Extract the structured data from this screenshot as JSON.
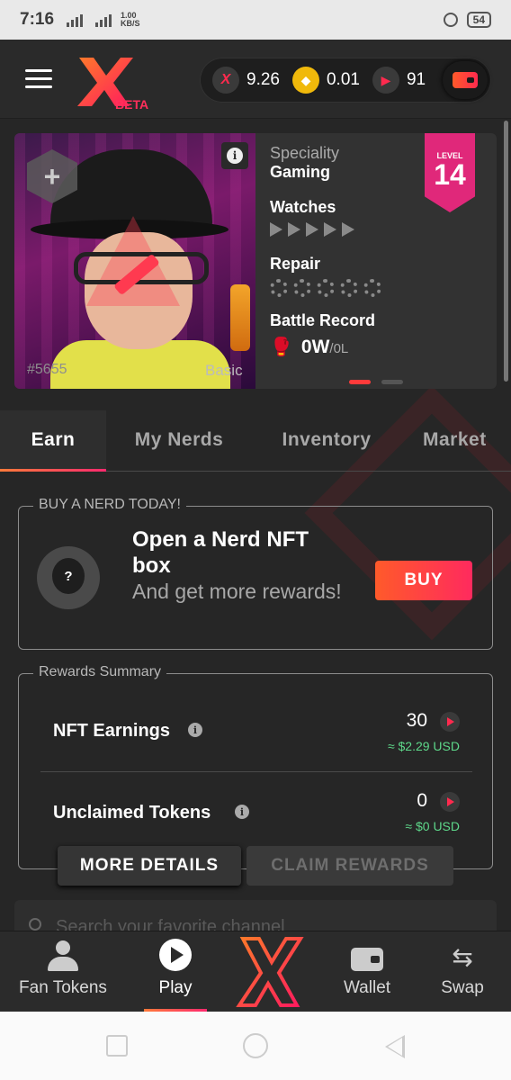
{
  "status_bar": {
    "time": "7:16",
    "net_speed_value": "1.00",
    "net_speed_unit": "KB/S",
    "battery": "54"
  },
  "header": {
    "beta_label": "BETA",
    "balances": [
      {
        "icon": "x-token-icon",
        "value": "9.26"
      },
      {
        "icon": "bnb-coin-icon",
        "value": "0.01"
      },
      {
        "icon": "play-token-icon",
        "value": "91"
      }
    ]
  },
  "nft_card": {
    "id_label": "#5655",
    "tier": "Basic",
    "speciality_label": "Speciality",
    "speciality_value": "Gaming",
    "watches_label": "Watches",
    "repair_label": "Repair",
    "battle_label": "Battle Record",
    "battle_wins": "0W",
    "battle_losses": "/0L",
    "level_label": "LEVEL",
    "level_value": "14"
  },
  "tabs": [
    {
      "label": "Earn",
      "active": true
    },
    {
      "label": "My Nerds",
      "active": false
    },
    {
      "label": "Inventory",
      "active": false
    },
    {
      "label": "Market",
      "active": false
    }
  ],
  "buy_box": {
    "legend": "BUY A NERD TODAY!",
    "title": "Open a Nerd NFT box",
    "subtitle": "And get more rewards!",
    "avatar_text": "?",
    "button": "BUY"
  },
  "rewards": {
    "legend": "Rewards Summary",
    "rows": [
      {
        "label": "NFT Earnings",
        "value": "30",
        "usd": "≈ $2.29 USD"
      },
      {
        "label": "Unclaimed Tokens",
        "value": "0",
        "usd": "≈ $0 USD"
      }
    ],
    "more_details": "MORE DETAILS",
    "claim_rewards": "CLAIM REWARDS"
  },
  "search": {
    "placeholder": "Search your favorite channel"
  },
  "bottom_nav": [
    {
      "label": "Fan Tokens",
      "icon": "person-icon"
    },
    {
      "label": "Play",
      "icon": "play-icon",
      "active": true
    },
    {
      "label": "",
      "icon": "x-logo-icon"
    },
    {
      "label": "Wallet",
      "icon": "wallet-icon"
    },
    {
      "label": "Swap",
      "icon": "swap-icon"
    }
  ],
  "colors": {
    "accent": "#ff2a4e",
    "accent_orange": "#ff5a2a",
    "level_badge": "#e0287a",
    "usd_green": "#5ed88a",
    "background": "#262626"
  }
}
